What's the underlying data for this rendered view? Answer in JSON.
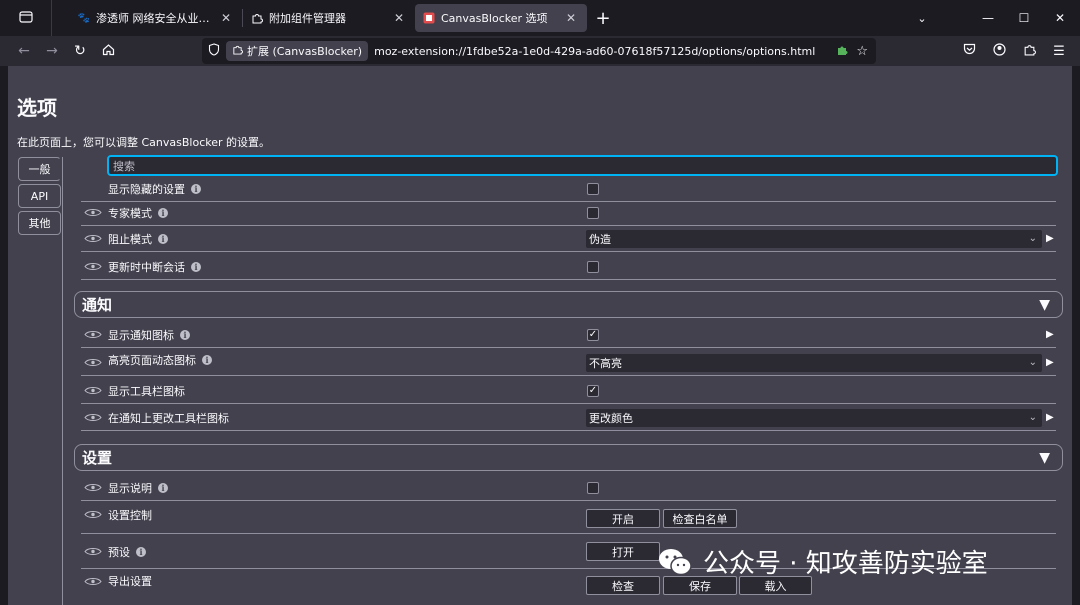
{
  "tabs": [
    {
      "title": "渗透师 网络安全从业者安全导航",
      "icon": "paw-icon",
      "active": false
    },
    {
      "title": "附加组件管理器",
      "icon": "puzzle-icon",
      "active": false
    },
    {
      "title": "CanvasBlocker 选项",
      "icon": "canvasblocker-icon",
      "active": true
    }
  ],
  "urlbar": {
    "identity": "扩展 (CanvasBlocker)",
    "url": "moz-extension://1fdbe52a-1e0d-429a-ad60-07618f57125d/options/options.html"
  },
  "page": {
    "title": "选项",
    "description": "在此页面上，您可以调整 CanvasBlocker 的设置。",
    "search_placeholder": "搜索"
  },
  "side_tabs": [
    "一般",
    "API",
    "其他"
  ],
  "rows": {
    "show_hidden": "显示隐藏的设置",
    "expert_mode": "专家模式",
    "block_mode": "阻止模式",
    "block_mode_value": "伪造",
    "stop_on_update": "更新时中断会话",
    "show_notif_icon": "显示通知图标",
    "highlight_page_action": "高亮页面动态图标",
    "highlight_page_action_value": "不高亮",
    "show_toolbar_icon": "显示工具栏图标",
    "change_toolbar_icon": "在通知上更改工具栏图标",
    "change_toolbar_icon_value": "更改颜色",
    "show_descriptions": "显示说明",
    "settings_control": "设置控制",
    "presets": "预设",
    "export_settings": "导出设置"
  },
  "sections": {
    "notifications": "通知",
    "settings": "设置"
  },
  "buttons": {
    "open": "开启",
    "check_whitelist": "检查白名单",
    "open_preset": "打开",
    "inspect": "检查",
    "save": "保存",
    "load": "载入"
  },
  "watermark": "公众号 · 知攻善防实验室"
}
